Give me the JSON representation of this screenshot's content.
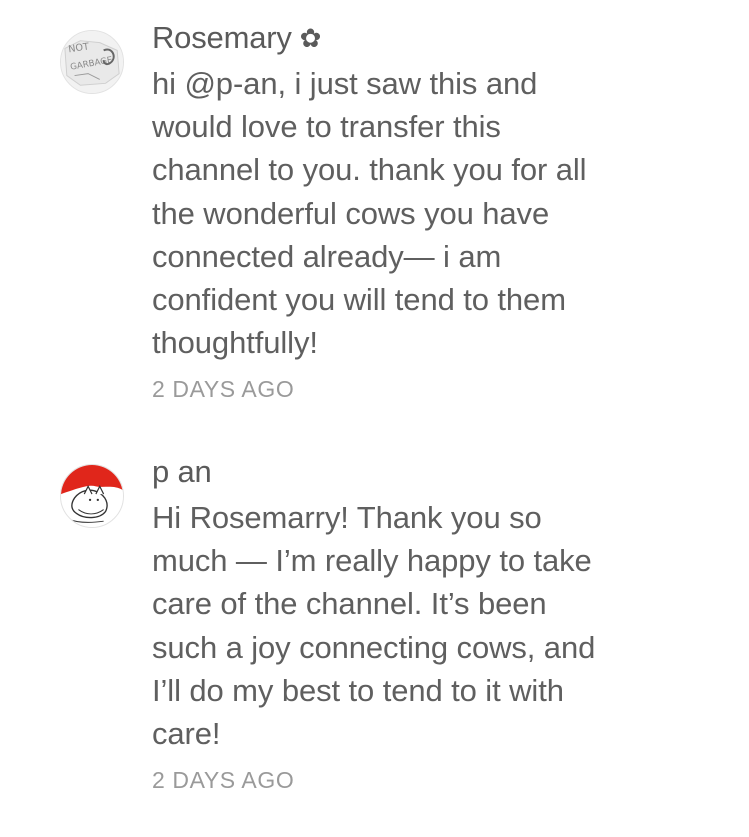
{
  "comments": [
    {
      "author": "Rosemary",
      "author_icon": "flower-icon",
      "avatar_text": "NOT GARBAGE",
      "body": "hi @p-an, i just saw this and\nwould love to transfer this\nchannel to you. thank you for all\nthe wonderful cows you have\nconnected already— i am\nconfident you will tend to them\nthoughtfully!",
      "time": "2 DAYS AGO"
    },
    {
      "author": "p an",
      "avatar_colors": {
        "top": "#e0261b",
        "bottom": "#ffffff"
      },
      "body": "Hi Rosemarry! Thank you so\nmuch — I’m really happy to take\ncare of the channel. It’s been\nsuch a joy connecting cows, and\nI’ll do my best to tend to it with\ncare!",
      "time": "2 DAYS AGO"
    }
  ]
}
